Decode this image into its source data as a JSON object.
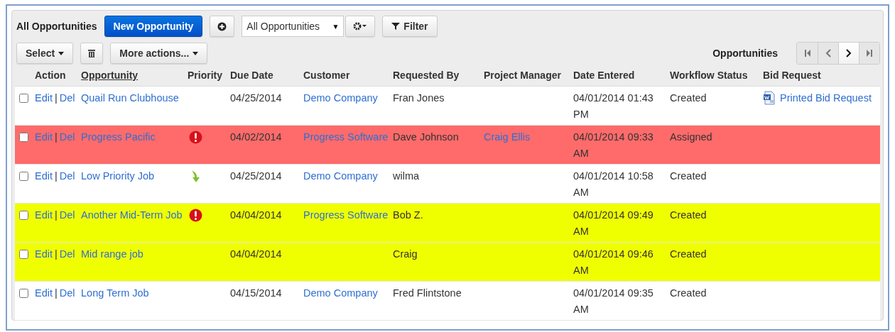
{
  "toolbar": {
    "title": "All Opportunities",
    "new_button": "New Opportunity",
    "view_select": {
      "value": "All Opportunities",
      "arrow": "▼"
    },
    "filter_button": "Filter"
  },
  "actions": {
    "select_button": "Select",
    "more_button": "More actions...",
    "list_title": "Opportunities",
    "pager": [
      {
        "kind": "first",
        "disabled": true
      },
      {
        "kind": "prev",
        "disabled": true
      },
      {
        "kind": "next",
        "disabled": false
      },
      {
        "kind": "last",
        "disabled": true
      }
    ]
  },
  "table": {
    "columns": [
      {
        "label": "Action",
        "sorted": false
      },
      {
        "label": "Opportunity",
        "sorted": true
      },
      {
        "label": "Priority",
        "sorted": false
      },
      {
        "label": "Due Date",
        "sorted": false
      },
      {
        "label": "Customer",
        "sorted": false
      },
      {
        "label": "Requested By",
        "sorted": false
      },
      {
        "label": "Project Manager",
        "sorted": false
      },
      {
        "label": "Date Entered",
        "sorted": false
      },
      {
        "label": "Workflow Status",
        "sorted": false
      },
      {
        "label": "Bid Request",
        "sorted": false
      }
    ],
    "rows": [
      {
        "checked": false,
        "color": "#ffffff",
        "edit": "Edit",
        "separator": "|",
        "del": "Del",
        "opportunity": "Quail Run Clubhouse",
        "due_date": "04/25/2014",
        "customer": "Demo Company",
        "requested_by": "Fran Jones",
        "date_entered": "04/01/2014 01:43 PM",
        "status": "Created",
        "bid_request": "Printed Bid Request"
      },
      {
        "checked": false,
        "color": "#ff6b6b",
        "edit": "Edit",
        "separator": "|",
        "del": "Del",
        "opportunity": "Progress Pacific",
        "priority": {
          "kind": "high"
        },
        "due_date": "04/02/2014",
        "customer": "Progress Software",
        "requested_by": "Dave Johnson",
        "project_manager": "Craig Ellis",
        "date_entered": "04/01/2014 09:33 AM",
        "status": "Assigned"
      },
      {
        "checked": false,
        "color": "#ffffff",
        "edit": "Edit",
        "separator": "|",
        "del": "Del",
        "opportunity": "Low Priority Job",
        "priority": {
          "kind": "low"
        },
        "due_date": "04/25/2014",
        "customer": "Demo Company",
        "requested_by": "wilma",
        "date_entered": "04/01/2014 10:58 AM",
        "status": "Created"
      },
      {
        "checked": false,
        "color": "#f0ff00",
        "edit": "Edit",
        "separator": "|",
        "del": "Del",
        "opportunity": "Another Mid-Term Job",
        "priority": {
          "kind": "high"
        },
        "due_date": "04/04/2014",
        "customer": "Progress Software",
        "requested_by": "Bob Z.",
        "date_entered": "04/01/2014 09:49 AM",
        "status": "Created"
      },
      {
        "checked": false,
        "color": "#f0ff00",
        "edit": "Edit",
        "separator": "|",
        "del": "Del",
        "opportunity": "Mid range job",
        "due_date": "04/04/2014",
        "requested_by": "Craig",
        "date_entered": "04/01/2014 09:46 AM",
        "status": "Created"
      },
      {
        "checked": false,
        "color": "#ffffff",
        "edit": "Edit",
        "separator": "|",
        "del": "Del",
        "opportunity": "Long Term Job",
        "due_date": "04/15/2014",
        "customer": "Demo Company",
        "requested_by": "Fred Flintstone",
        "date_entered": "04/01/2014 09:35 AM",
        "status": "Created"
      }
    ]
  }
}
